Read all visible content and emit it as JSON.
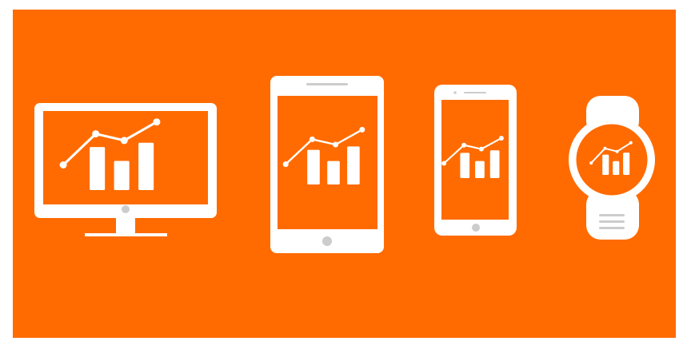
{
  "scene": {
    "background_color": "#ff6b00",
    "device_color": "#ffffff",
    "detail_color": "#cccccc",
    "devices": [
      {
        "kind": "desktop-monitor",
        "icon": "desktop-monitor-icon"
      },
      {
        "kind": "tablet",
        "icon": "tablet-icon"
      },
      {
        "kind": "smartphone",
        "icon": "smartphone-icon"
      },
      {
        "kind": "smartwatch",
        "icon": "smartwatch-icon"
      }
    ],
    "screen_graphic": {
      "icon": "bar-line-chart-icon",
      "bar_levels": [
        0.62,
        0.42,
        0.68
      ],
      "line_levels": [
        0.35,
        0.82,
        0.72,
        1.0
      ]
    }
  }
}
